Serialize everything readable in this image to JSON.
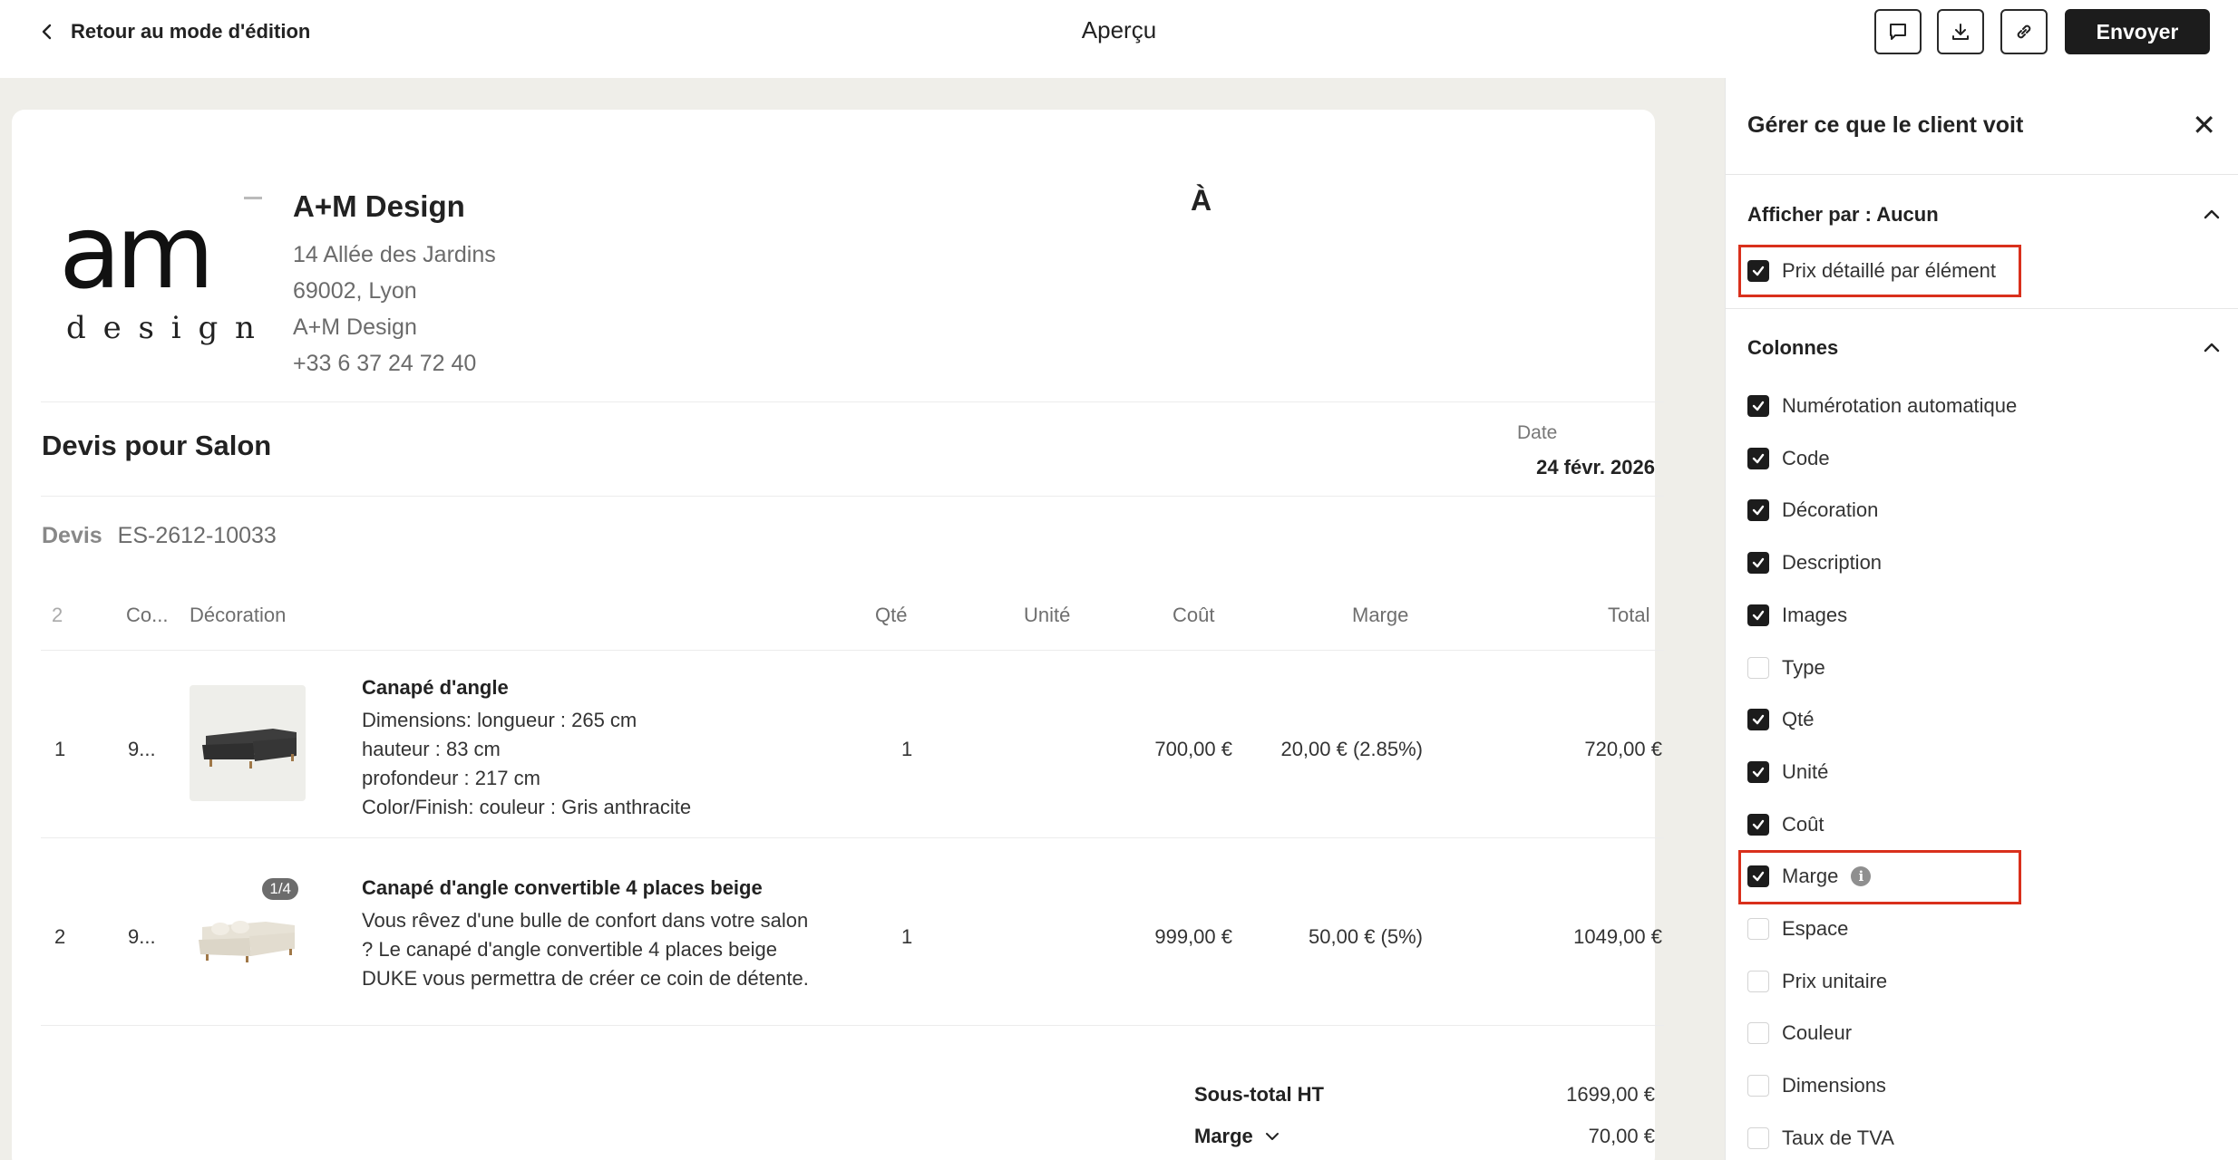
{
  "header": {
    "back_label": "Retour au mode d'édition",
    "title": "Aperçu",
    "send_label": "Envoyer",
    "icons": [
      "comment-icon",
      "download-icon",
      "link-icon"
    ]
  },
  "company": {
    "name": "A+M Design",
    "address1": "14 Allée des Jardins",
    "address2": "69002, Lyon",
    "address3": "A+M Design",
    "phone": "+33 6 37 24 72 40",
    "logo_top": "am",
    "logo_bottom": "d e s i g n s"
  },
  "recipient": {
    "label": "À"
  },
  "quote": {
    "title": "Devis pour Salon",
    "date_label": "Date",
    "date_value": "24 févr. 2026",
    "devis_label": "Devis",
    "devis_number": "ES-2612-10033"
  },
  "table": {
    "headers": {
      "num": "2",
      "code": "Co...",
      "decoration": "Décoration",
      "qty": "Qté",
      "unit": "Unité",
      "cost": "Coût",
      "margin": "Marge",
      "total": "Total"
    },
    "rows": [
      {
        "num": "1",
        "code": "9...",
        "title": "Canapé d'angle",
        "desc_lines": [
          "Dimensions: longueur : 265 cm",
          "hauteur : 83 cm",
          "profondeur : 217 cm",
          "Color/Finish: couleur : Gris anthracite"
        ],
        "qty": "1",
        "cost": "700,00 €",
        "margin": "20,00 € (2.85%)",
        "total": "720,00 €",
        "image_badge": ""
      },
      {
        "num": "2",
        "code": "9...",
        "title": "Canapé d'angle convertible 4 places beige",
        "desc_lines": [
          "Vous rêvez d'une bulle de confort dans votre salon",
          "? Le canapé d'angle convertible 4 places beige",
          "DUKE vous permettra de créer ce coin de détente."
        ],
        "qty": "1",
        "cost": "999,00 €",
        "margin": "50,00 € (5%)",
        "total": "1049,00 €",
        "image_badge": "1/4"
      }
    ]
  },
  "totals": {
    "subtotal_label": "Sous-total HT",
    "subtotal_value": "1699,00 €",
    "margin_label": "Marge",
    "margin_value": "70,00 €"
  },
  "panel": {
    "title": "Gérer ce que le client voit",
    "display_section": "Afficher par : Aucun",
    "display_option": {
      "label": "Prix détaillé par élément",
      "checked": true
    },
    "columns_section": "Colonnes",
    "columns": [
      {
        "label": "Numérotation automatique",
        "checked": true
      },
      {
        "label": "Code",
        "checked": true
      },
      {
        "label": "Décoration",
        "checked": true
      },
      {
        "label": "Description",
        "checked": true
      },
      {
        "label": "Images",
        "checked": true
      },
      {
        "label": "Type",
        "checked": false
      },
      {
        "label": "Qté",
        "checked": true
      },
      {
        "label": "Unité",
        "checked": true
      },
      {
        "label": "Coût",
        "checked": true
      },
      {
        "label": "Marge",
        "checked": true,
        "info": true
      },
      {
        "label": "Espace",
        "checked": false
      },
      {
        "label": "Prix unitaire",
        "checked": false
      },
      {
        "label": "Couleur",
        "checked": false
      },
      {
        "label": "Dimensions",
        "checked": false
      },
      {
        "label": "Taux de TVA",
        "checked": false
      }
    ],
    "highlight_color": "#d9301c"
  }
}
